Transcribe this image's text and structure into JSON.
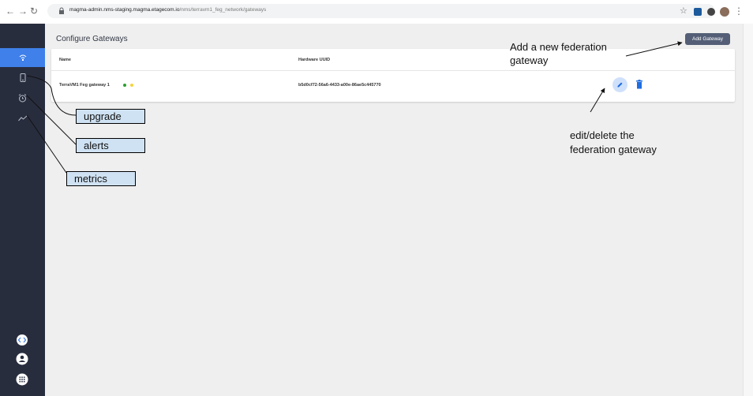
{
  "browser": {
    "url_host": "magma-admin.nms-staging.magma.etagecom.io",
    "url_path": "/nms/terravm1_feg_network/gateways"
  },
  "page": {
    "title": "Configure Gateways",
    "add_button": "Add Gateway"
  },
  "table": {
    "columns": [
      "Name",
      "Hardware UUID"
    ],
    "rows": [
      {
        "name": "TerraVM1 Feg gateway 1",
        "uuid": "b5d0cf72-56a6-4433-a00e-86ae5c445770"
      }
    ]
  },
  "annotations": {
    "add_new": "Add a new federation gateway",
    "add_new_line1": "Add a new federation",
    "add_new_line2": "gateway",
    "edit_delete_line1": "edit/delete the",
    "edit_delete_line2": "federation gateway",
    "upgrade": "upgrade",
    "alerts": "alerts",
    "metrics": "metrics"
  },
  "colors": {
    "sidebar": "#282d3e",
    "active": "#3f80ea",
    "status_green": "#2ca02c",
    "status_yellow": "#f5d33d",
    "callout": "#cfe2f3"
  },
  "icons": [
    "back-arrow-icon",
    "forward-arrow-icon",
    "reload-icon",
    "lock-icon",
    "star-icon",
    "wifi-icon",
    "phone-icon",
    "alarm-icon",
    "chart-icon",
    "code-icon",
    "account-icon",
    "apps-icon",
    "edit-icon",
    "delete-icon"
  ]
}
